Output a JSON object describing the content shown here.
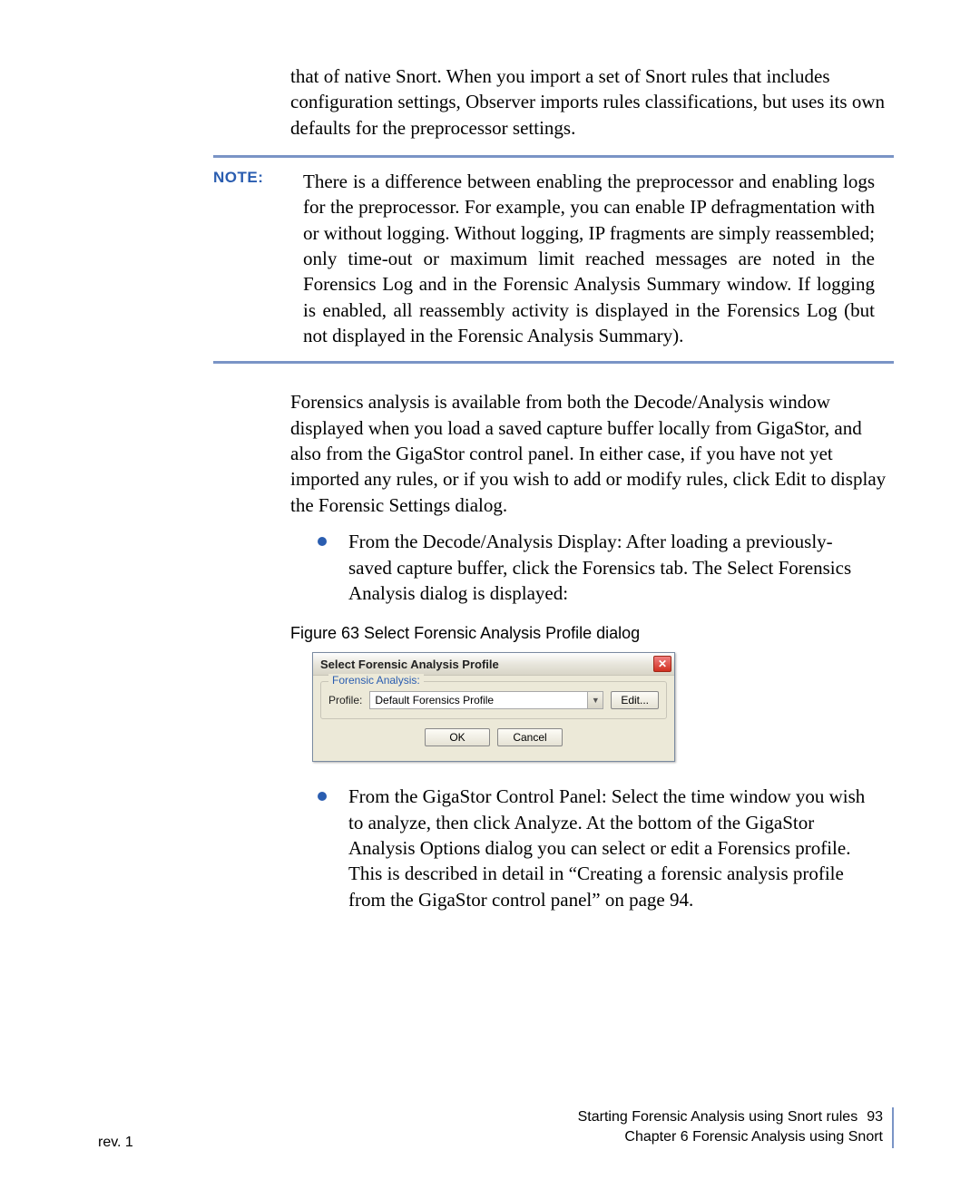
{
  "intro_paragraph": "that of native Snort. When you import a set of Snort rules that includes configuration settings, Observer imports rules classifications, but uses its own defaults for the preprocessor settings.",
  "note": {
    "label": "NOTE:",
    "text": "There is a difference between enabling the preprocessor and enabling logs for the preprocessor. For example, you can enable IP defragmentation with or without logging. Without logging, IP fragments are simply reassembled; only time-out or maximum limit reached messages are noted in the Forensics Log and in the Forensic Analysis Summary window. If logging is enabled, all reassembly activity is displayed in the Forensics Log (but not displayed in the Forensic Analysis Summary)."
  },
  "para2": "Forensics analysis is available from both the Decode/Analysis window displayed when you load a saved capture buffer locally from GigaStor, and also from the GigaStor control panel. In either case, if you have not yet imported any rules, or if you wish to add or modify rules, click Edit to display the Forensic Settings dialog.",
  "bullet1": "From the Decode/Analysis Display: After loading a previously-saved capture buffer, click the Forensics tab. The Select Forensics Analysis dialog is displayed:",
  "figure_caption": "Figure 63  Select Forensic Analysis Profile dialog",
  "dialog": {
    "title": "Select Forensic Analysis Profile",
    "close_glyph": "✕",
    "legend": "Forensic Analysis:",
    "profile_label": "Profile:",
    "profile_value": "Default Forensics Profile",
    "edit_button": "Edit...",
    "ok_button": "OK",
    "cancel_button": "Cancel"
  },
  "bullet2": "From the GigaStor Control Panel: Select the time window you wish to analyze, then click Analyze. At the bottom of the GigaStor Analysis Options dialog you can select or edit a Forensics profile. This is described in detail in “Creating a forensic analysis profile from the GigaStor control panel” on page 94.",
  "footer": {
    "rev": "rev. 1",
    "line1": "Starting Forensic Analysis using Snort rules",
    "pagenum": "93",
    "line2": "Chapter 6 Forensic Analysis using Snort"
  }
}
